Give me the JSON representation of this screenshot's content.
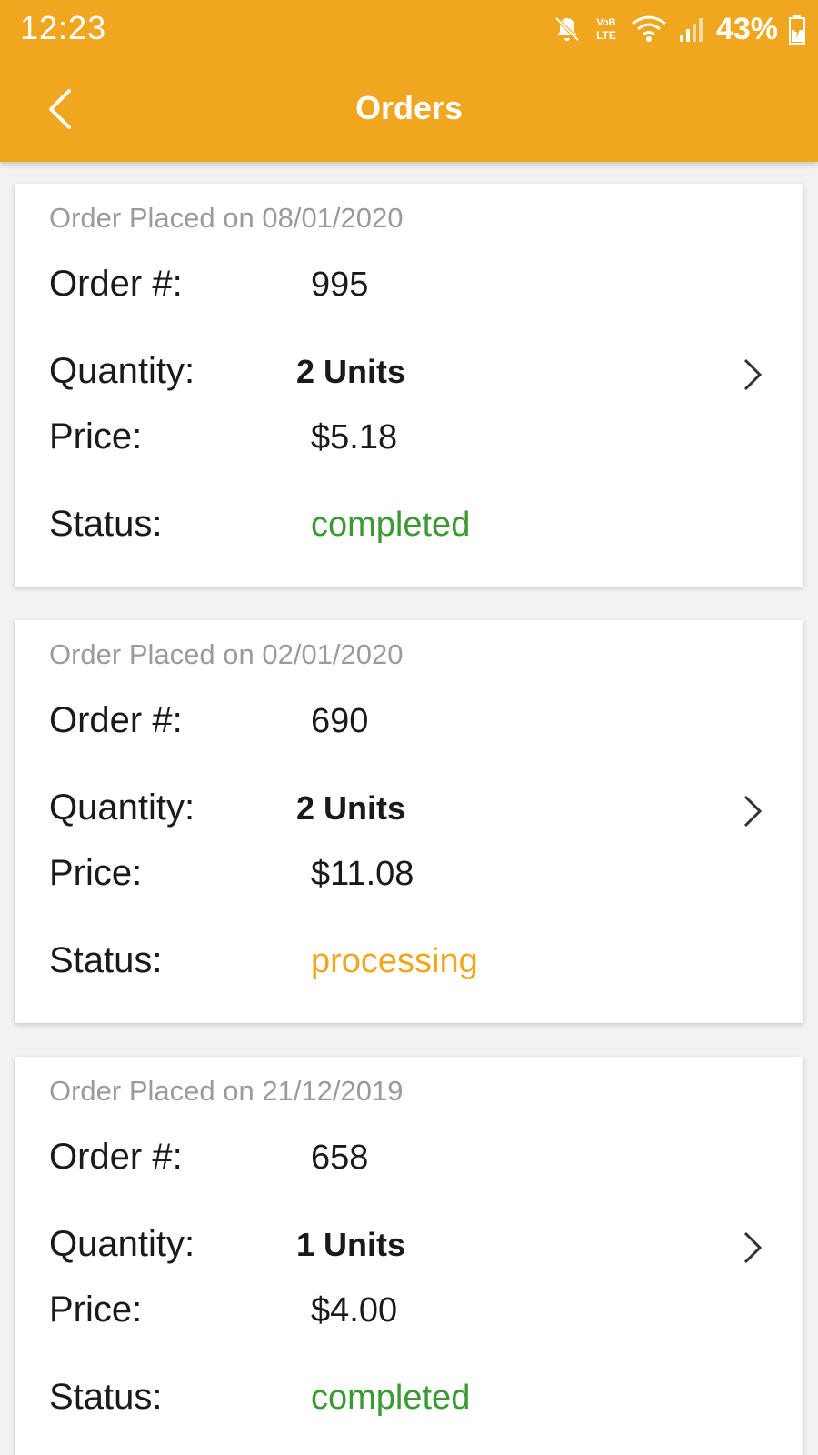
{
  "status_bar": {
    "time": "12:23",
    "network": "LTE",
    "battery": "43%"
  },
  "header": {
    "title": "Orders",
    "back_icon": "chevron-left-icon"
  },
  "labels": {
    "order": "Order #:",
    "quantity": "Quantity:",
    "price": "Price:",
    "status": "Status:"
  },
  "orders": [
    {
      "placed": "Order Placed on 08/01/2020",
      "number": "995",
      "quantity": "2 Units",
      "price": "$5.18",
      "status": "completed",
      "status_color": "#3a9a32"
    },
    {
      "placed": "Order Placed on 02/01/2020",
      "number": "690",
      "quantity": "2 Units",
      "price": "$11.08",
      "status": "processing",
      "status_color": "#f0a61e"
    },
    {
      "placed": "Order Placed on 21/12/2019",
      "number": "658",
      "quantity": "1 Units",
      "price": "$4.00",
      "status": "completed",
      "status_color": "#3a9a32"
    }
  ],
  "colors": {
    "accent": "#f0a61e",
    "completed": "#3a9a32",
    "processing": "#f0a61e"
  }
}
